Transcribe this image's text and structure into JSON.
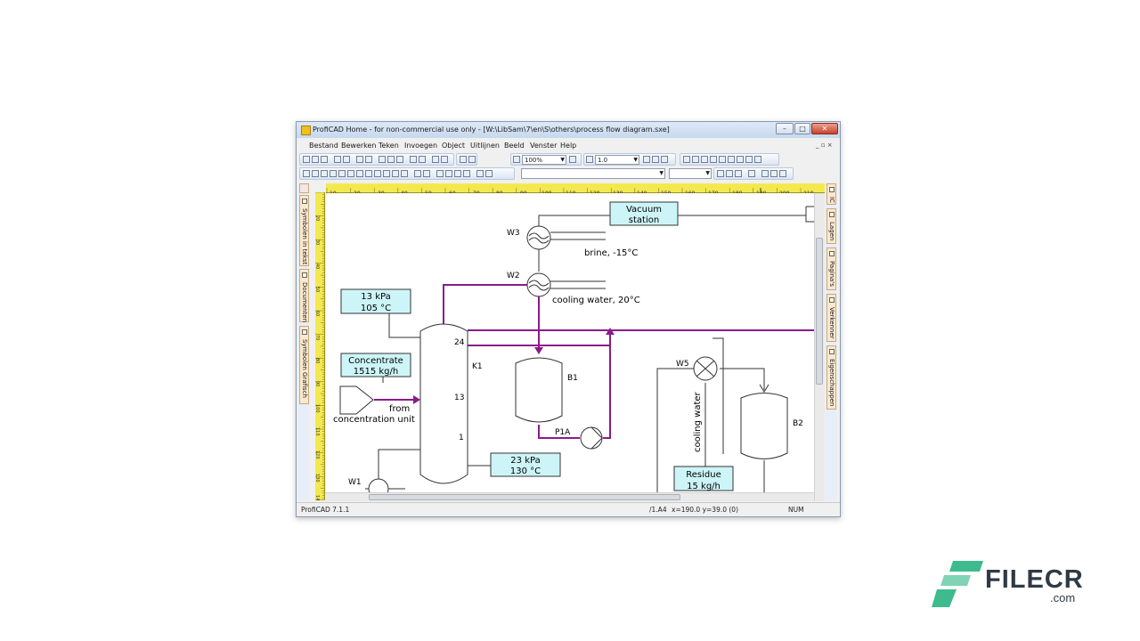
{
  "window": {
    "title": "ProfiCAD Home - for non-commercial use only - [W:\\LibSam\\7\\en\\S\\others\\process flow diagram.sxe]",
    "controls": {
      "minimize": "–",
      "maximize": "□",
      "close": "✕"
    },
    "mdi_controls": "_ ▫ ×"
  },
  "menu": [
    "Bestand",
    "Bewerken",
    "Teken",
    "Invoegen",
    "Object",
    "Uitlijnen",
    "Beeld",
    "Venster",
    "Help"
  ],
  "toolbar": {
    "zoom_value": "100%",
    "line_width_value": "1.0",
    "font_value": ""
  },
  "left_tabs": [
    {
      "label": "Symbolen in tekst",
      "icon": "symbol-text-icon"
    },
    {
      "label": "Documenten",
      "icon": "documents-icon"
    },
    {
      "label": "Symbolen Grafisch",
      "icon": "symbol-graphic-icon"
    }
  ],
  "right_tabs": [
    {
      "label": "IC",
      "icon": "ic-icon"
    },
    {
      "label": "Lagen",
      "icon": "layers-icon"
    },
    {
      "label": "Pagina's",
      "icon": "pages-icon"
    },
    {
      "label": "Verkenner",
      "icon": "explorer-icon"
    },
    {
      "label": "Eigenschappen",
      "icon": "properties-icon"
    }
  ],
  "ruler_h": [
    "10",
    "20",
    "30",
    "40",
    "50",
    "60",
    "70",
    "80",
    "90",
    "100",
    "110",
    "120",
    "130",
    "140",
    "150",
    "160",
    "170",
    "180",
    "190",
    "200",
    "210"
  ],
  "ruler_v": [
    "20",
    "30",
    "40",
    "50",
    "60",
    "70",
    "80",
    "90",
    "100",
    "110",
    "120",
    "130",
    "140"
  ],
  "diagram": {
    "vacuum_line1": "Vacuum",
    "vacuum_line2": "station",
    "w3": "W3",
    "w2": "W2",
    "w5": "W5",
    "w1": "W1",
    "brine": "brine, -15°C",
    "cooling_water_w2": "cooling water, 20°C",
    "k1": "K1",
    "b1": "B1",
    "b2": "B2",
    "p1a": "P1A",
    "box_top_line1": "13 kPa",
    "box_top_line2": "105 °C",
    "concentrate_line1": "Concentrate",
    "concentrate_line2": "1515 kg/h",
    "from_line1": "from",
    "from_line2": "concentration unit",
    "tray_24": "24",
    "tray_13": "13",
    "tray_1": "1",
    "box_bottom_line1": "23 kPa",
    "box_bottom_line2": "130 °C",
    "cooling_water_vertical": "cooling water",
    "residue_line1": "Residue",
    "residue_line2": "15 kg/h",
    "process_color": "#8b1a8b",
    "label_fill": "#cdf5f8"
  },
  "status": {
    "app_version": "ProfiCAD 7.1.1",
    "page_ref": "/1.A4",
    "coords": "x=190.0  y=39.0 (0)",
    "num": "NUM"
  },
  "watermark": {
    "word": "FILECR",
    "sub": ".com",
    "color": "#3dbb8f"
  }
}
